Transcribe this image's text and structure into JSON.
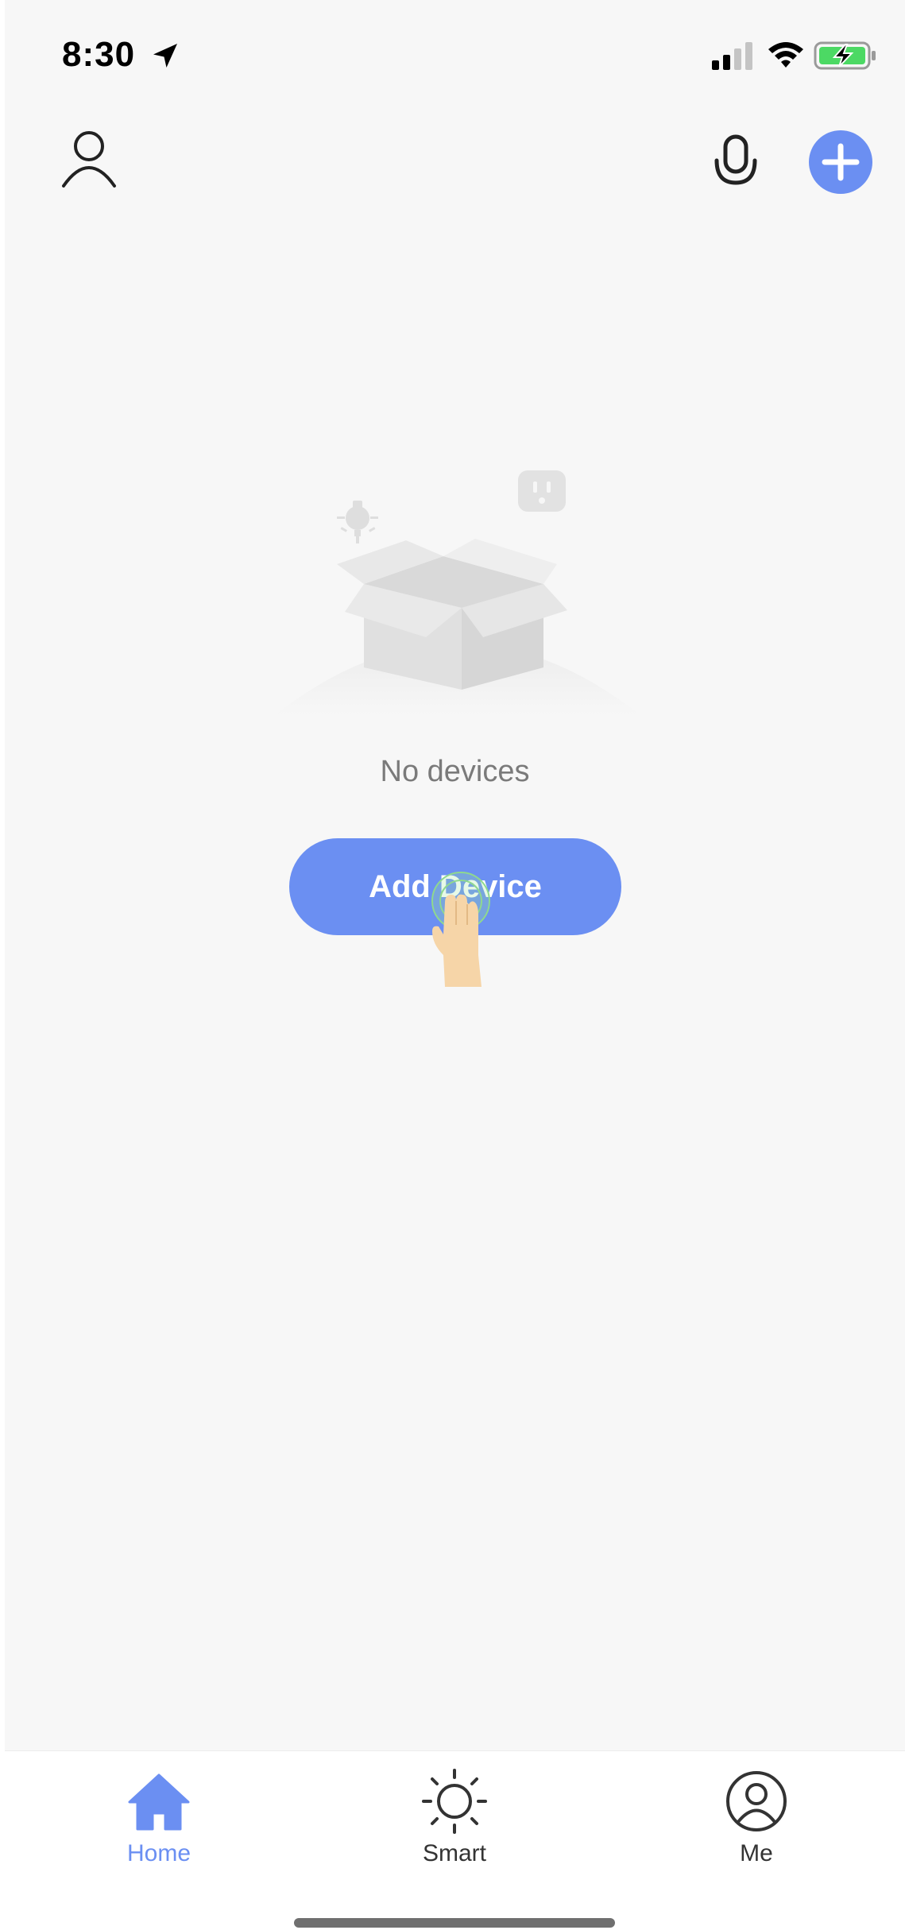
{
  "status_bar": {
    "time": "8:30"
  },
  "main": {
    "empty_message": "No devices",
    "add_device_label": "Add Device"
  },
  "tabs": [
    {
      "label": "Home",
      "icon": "home-icon",
      "active": true
    },
    {
      "label": "Smart",
      "icon": "sun-icon",
      "active": false
    },
    {
      "label": "Me",
      "icon": "user-circle-icon",
      "active": false
    }
  ],
  "colors": {
    "accent": "#6b8ff2",
    "background": "#f7f7f7",
    "battery_charge": "#4cd964"
  }
}
